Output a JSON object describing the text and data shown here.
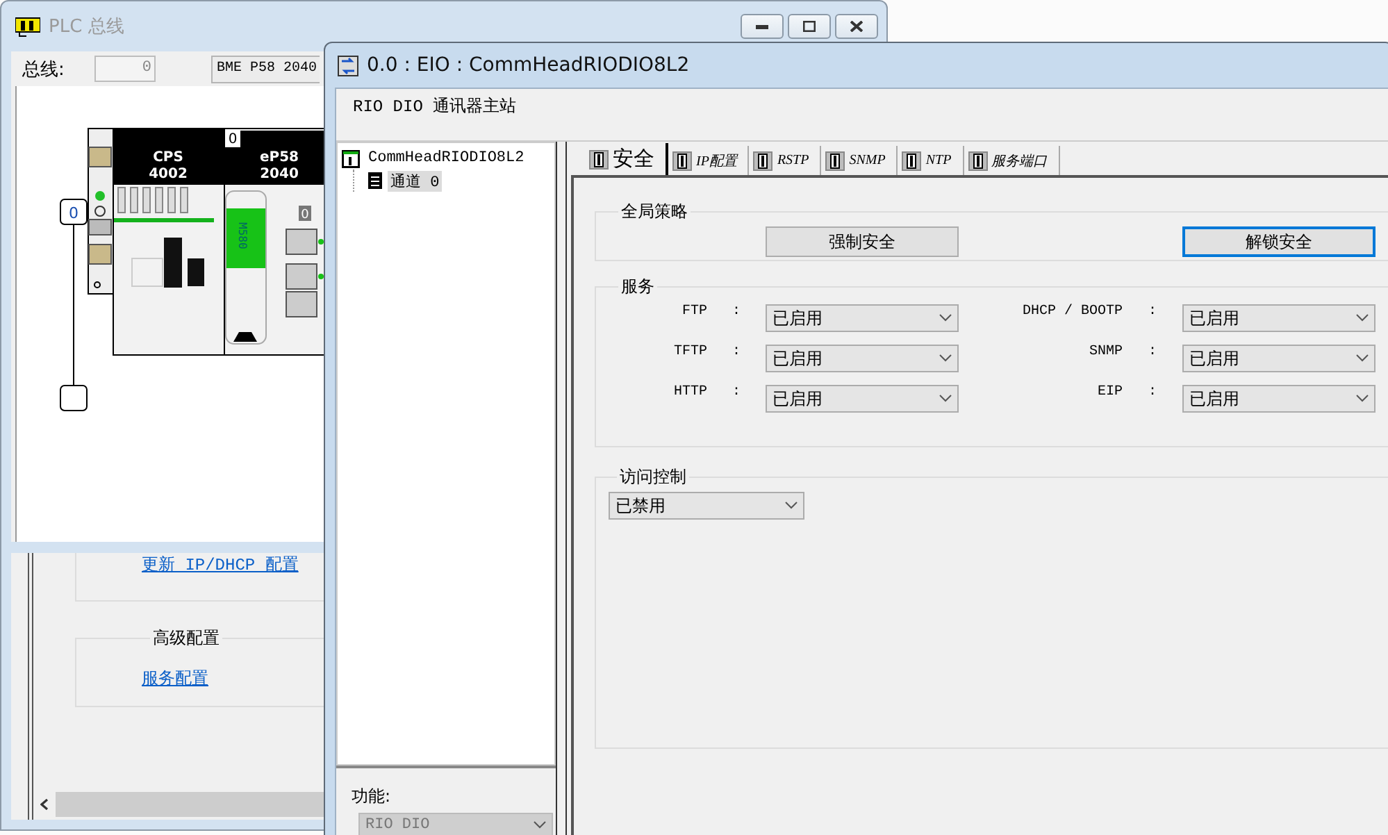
{
  "back_window": {
    "title": "PLC 总线",
    "bus_label": "总线:",
    "bus_value": "0",
    "module_name": "BME P58 2040",
    "rack": {
      "rack_number": "0",
      "slot_number": "0",
      "port_number": "0",
      "modules": [
        {
          "name": "CPS",
          "code": "4002"
        },
        {
          "name": "eP58",
          "code": "2040"
        }
      ],
      "cpu_label": "M580"
    },
    "top_link": "更新 IP/DHCP 配置",
    "advanced_group": {
      "title": "高级配置",
      "link": "服务配置"
    }
  },
  "front_window": {
    "title": "0.0 : EIO : CommHeadRIODIO8L2",
    "subtitle": "RIO DIO 通讯器主站",
    "tree": [
      {
        "label": "CommHeadRIODIO8L2",
        "selected": false,
        "children": [
          {
            "label": "通道 0",
            "selected": true
          }
        ]
      }
    ],
    "function": {
      "label": "功能:",
      "value": "RIO DIO",
      "disabled": true
    },
    "tabs": [
      {
        "label": "安全",
        "selected": true
      },
      {
        "label": "IP配置",
        "selected": false
      },
      {
        "label": "RSTP",
        "selected": false
      },
      {
        "label": "SNMP",
        "selected": false
      },
      {
        "label": "NTP",
        "selected": false
      },
      {
        "label": "服务端口",
        "selected": false
      }
    ],
    "global_policy": {
      "title": "全局策略",
      "buttons": [
        {
          "label": "强制安全",
          "focused": false
        },
        {
          "label": "解锁安全",
          "focused": true
        }
      ]
    },
    "services": {
      "title": "服务",
      "items": [
        {
          "label": "FTP",
          "separator": ":",
          "value": "已启用"
        },
        {
          "label": "DHCP / BOOTP",
          "separator": ":",
          "value": "已启用"
        },
        {
          "label": "TFTP",
          "separator": ":",
          "value": "已启用"
        },
        {
          "label": "SNMP",
          "separator": ":",
          "value": "已启用"
        },
        {
          "label": "HTTP",
          "separator": ":",
          "value": "已启用"
        },
        {
          "label": "EIP",
          "separator": ":",
          "value": "已启用"
        }
      ]
    },
    "access_control": {
      "title": "访问控制",
      "value": "已禁用"
    }
  }
}
